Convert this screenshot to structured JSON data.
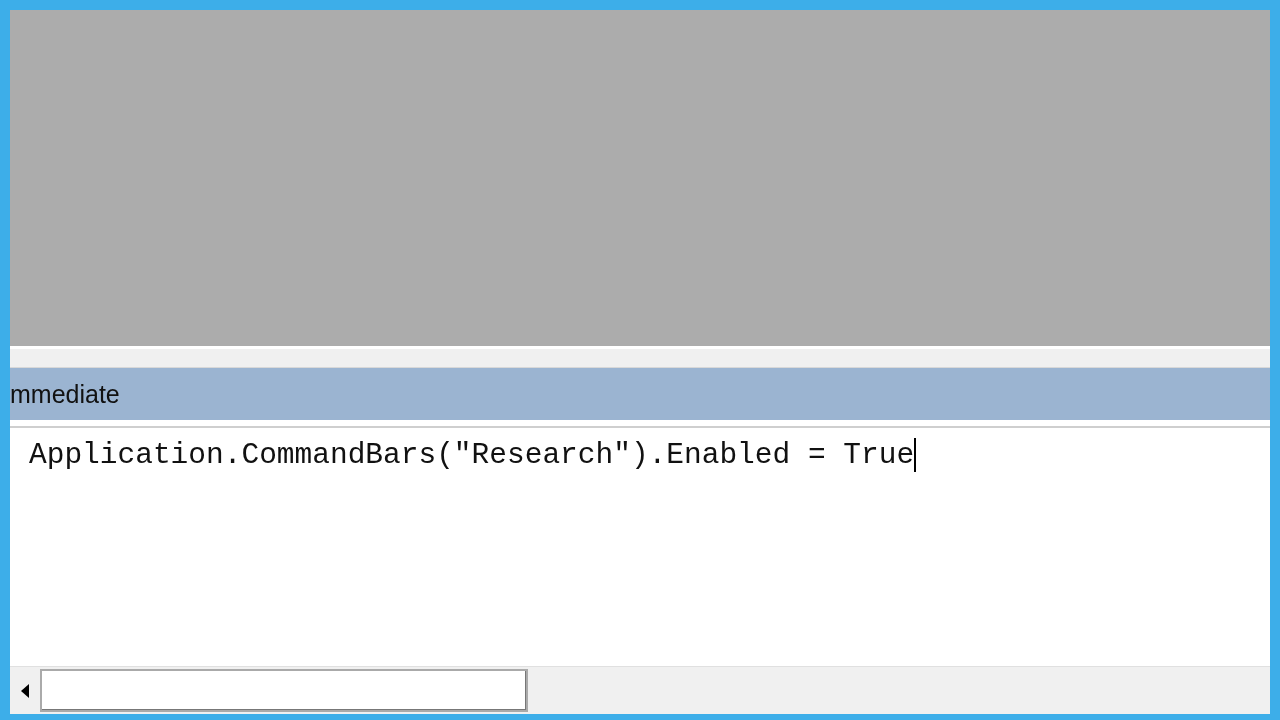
{
  "panel": {
    "title": "mmediate"
  },
  "code": {
    "lines": [
      "Application.CommandBars(\"Research\").Enabled = True"
    ]
  }
}
